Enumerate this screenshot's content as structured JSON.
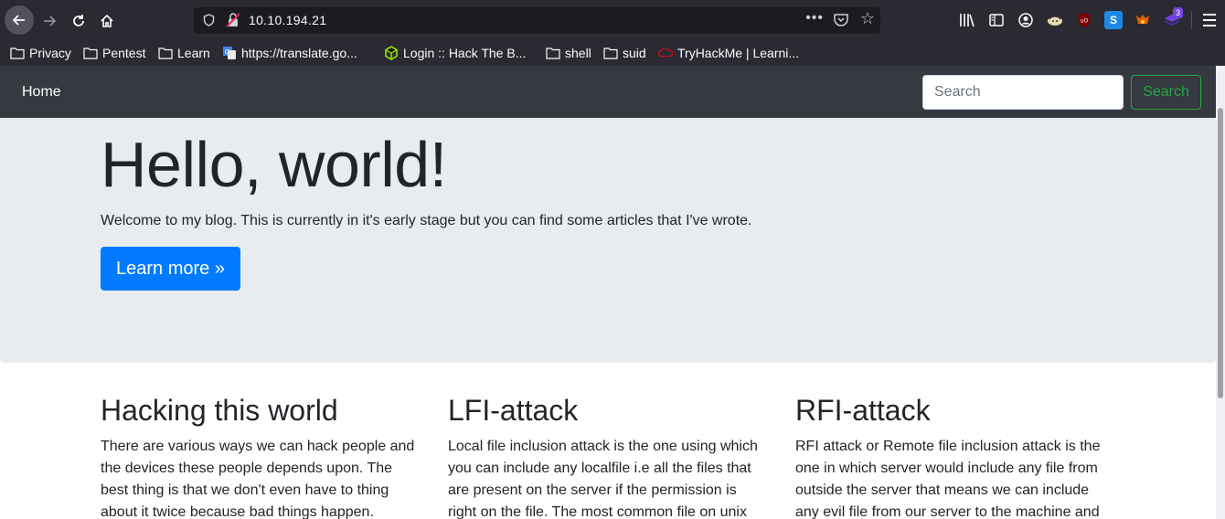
{
  "browser": {
    "url": "10.10.194.21",
    "extension_badge": "3",
    "bookmarks": [
      {
        "label": "Privacy",
        "icon": "folder-icon"
      },
      {
        "label": "Pentest",
        "icon": "folder-icon"
      },
      {
        "label": "Learn",
        "icon": "folder-icon"
      },
      {
        "label": "https://translate.go...",
        "icon": "google-translate-icon"
      },
      {
        "label": "Login :: Hack The B...",
        "icon": "hackthebox-icon"
      },
      {
        "label": "shell",
        "icon": "folder-icon"
      },
      {
        "label": "suid",
        "icon": "folder-icon"
      },
      {
        "label": "TryHackMe | Learni...",
        "icon": "tryhackme-icon"
      }
    ]
  },
  "navbar": {
    "home_label": "Home",
    "search_placeholder": "Search",
    "search_button": "Search"
  },
  "jumbotron": {
    "title": "Hello, world!",
    "lead": "Welcome to my blog. This is currently in it's early stage but you can find some articles that I've wrote.",
    "button": "Learn more »"
  },
  "articles": [
    {
      "title": "Hacking this world",
      "body": "There are various ways we can hack people and the devices these people depends upon. The best thing is that we don't even have to thing about it twice because bad things happen."
    },
    {
      "title": "LFI-attack",
      "body": "Local file inclusion attack is the one using which you can include any localfile i.e all the files that are present on the server if the permission is right on the file. The most common file on unix"
    },
    {
      "title": "RFI-attack",
      "body": "RFI attack or Remote file inclusion attack is the one in which server would include any file from outside the server that means we can include any evil file from our server to the machine and"
    }
  ],
  "colors": {
    "navbar_bg": "#343a40",
    "jumbotron_bg": "#e9ecef",
    "primary": "#007bff",
    "success": "#28a745"
  }
}
